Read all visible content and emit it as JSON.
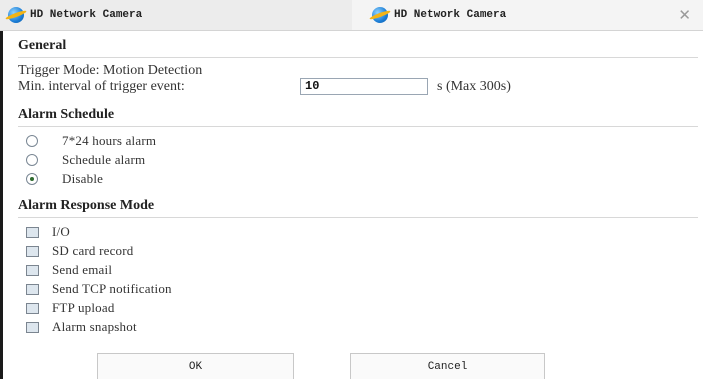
{
  "tabs": [
    {
      "title": "HD Network Camera"
    },
    {
      "title": "HD Network Camera",
      "close": "✕"
    }
  ],
  "general": {
    "heading": "General",
    "trigger_mode": "Trigger Mode: Motion Detection",
    "interval_label": "Min. interval of trigger event:",
    "interval_value": "10",
    "interval_unit": "s (Max 300s)"
  },
  "schedule": {
    "heading": "Alarm Schedule",
    "options": [
      "7*24 hours alarm",
      "Schedule alarm",
      "Disable"
    ],
    "selected": "Disable"
  },
  "response": {
    "heading": "Alarm Response Mode",
    "options": [
      "I/O",
      "SD card record",
      "Send email",
      "Send TCP notification",
      "FTP upload",
      "Alarm snapshot"
    ]
  },
  "buttons": {
    "ok": "OK",
    "cancel": "Cancel"
  },
  "icons": {
    "tab_icon": "ie-browser-icon",
    "close": "close-icon"
  }
}
